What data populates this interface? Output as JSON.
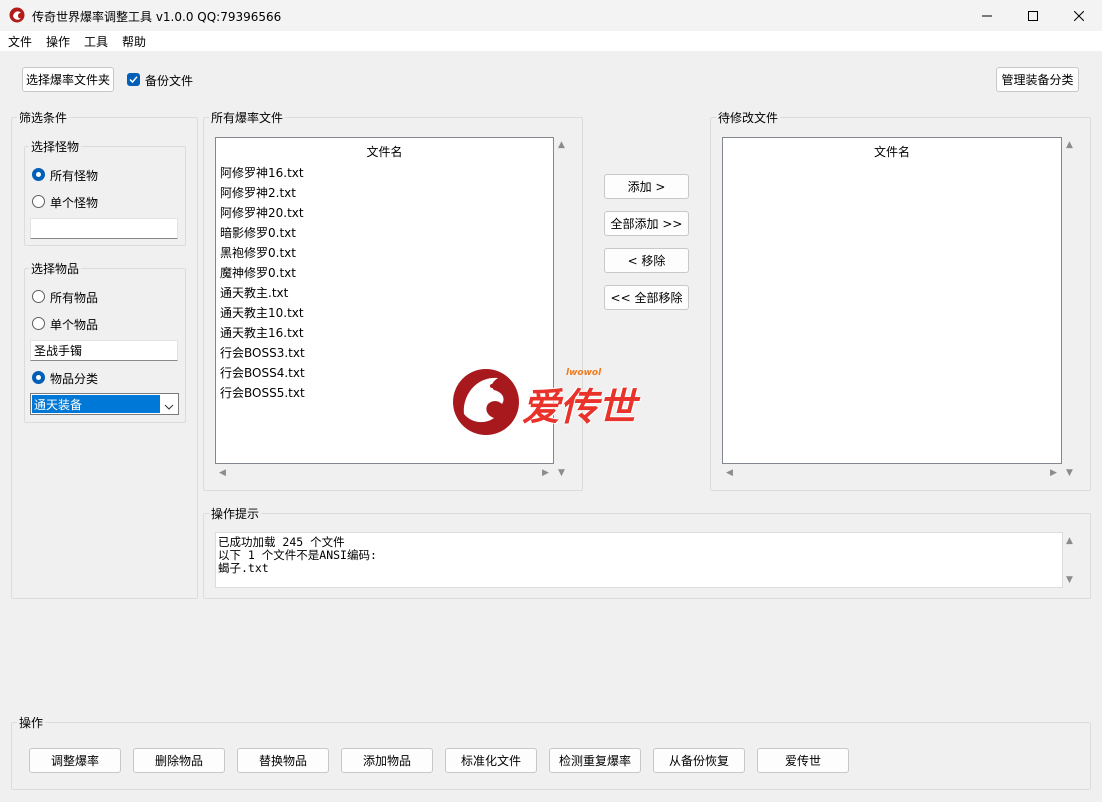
{
  "window": {
    "title": "传奇世界爆率调整工具 v1.0.0 QQ:79396566",
    "controls": [
      "minimize",
      "maximize",
      "close"
    ]
  },
  "menu": [
    "文件",
    "操作",
    "工具",
    "帮助"
  ],
  "toolbar": {
    "select_folder": "选择爆率文件夹",
    "backup_label": "备份文件",
    "backup_checked": true,
    "manage_category": "管理装备分类"
  },
  "filter": {
    "title": "筛选条件",
    "monster": {
      "title": "选择怪物",
      "all": "所有怪物",
      "single": "单个怪物",
      "selected": "all",
      "input_value": ""
    },
    "item": {
      "title": "选择物品",
      "all": "所有物品",
      "single": "单个物品",
      "input_value": "圣战手镯",
      "category": "物品分类",
      "selected": "category",
      "category_value": "通天装备"
    }
  },
  "all_files": {
    "title": "所有爆率文件",
    "column": "文件名",
    "rows": [
      "阿修罗神16.txt",
      "阿修罗神2.txt",
      "阿修罗神20.txt",
      "暗影修罗0.txt",
      "黑袍修罗0.txt",
      "魔神修罗0.txt",
      "通天教主.txt",
      "通天教主10.txt",
      "通天教主16.txt",
      "行会BOSS3.txt",
      "行会BOSS4.txt",
      "行会BOSS5.txt"
    ]
  },
  "transfer": {
    "add": "添加 >",
    "add_all": "全部添加 >>",
    "remove": "< 移除",
    "remove_all": "<< 全部移除"
  },
  "pending": {
    "title": "待修改文件",
    "column": "文件名",
    "rows": []
  },
  "log": {
    "title": "操作提示",
    "lines": [
      "已成功加载 245 个文件",
      "以下 1 个文件不是ANSI编码:",
      "蝎子.txt"
    ]
  },
  "watermark": {
    "text": "爱传世",
    "small_text": "lwowol",
    "colors": {
      "dragon": "#a8191e",
      "char1": "#e8322a",
      "char23": "#f07b1d"
    }
  },
  "actions": {
    "title": "操作",
    "buttons": [
      "调整爆率",
      "删除物品",
      "替换物品",
      "添加物品",
      "标准化文件",
      "检测重复爆率",
      "从备份恢复",
      "爱传世"
    ]
  },
  "colors": {
    "accent": "#005fb8",
    "selection": "#0078d7",
    "window_bg": "#f0f0f0"
  }
}
